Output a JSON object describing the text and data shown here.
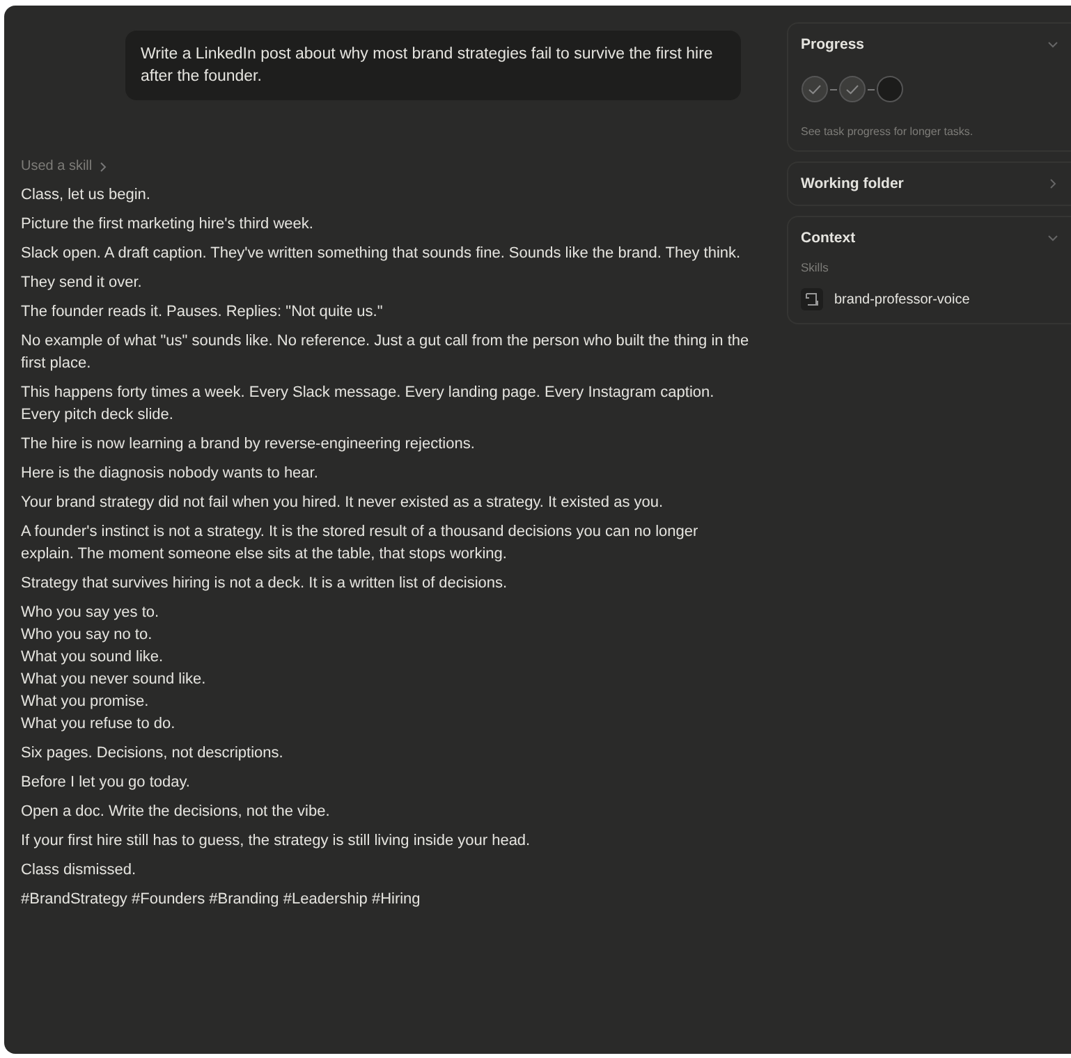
{
  "prompt": "Write a LinkedIn post about why most brand strategies fail to survive the first hire after the founder.",
  "skill_link": "Used a skill",
  "paragraphs": [
    {
      "kind": "text",
      "text": "Class, let us begin."
    },
    {
      "kind": "text",
      "text": "Picture the first marketing hire's third week."
    },
    {
      "kind": "text",
      "text": "Slack open. A draft caption. They've written something that sounds fine. Sounds like the brand. They think."
    },
    {
      "kind": "text",
      "text": "They send it over."
    },
    {
      "kind": "text",
      "text": "The founder reads it. Pauses. Replies: \"Not quite us.\""
    },
    {
      "kind": "text",
      "text": "No example of what \"us\" sounds like. No reference. Just a gut call from the person who built the thing in the first place."
    },
    {
      "kind": "text",
      "text": "This happens forty times a week. Every Slack message. Every landing page. Every Instagram caption. Every pitch deck slide."
    },
    {
      "kind": "text",
      "text": "The hire is now learning a brand by reverse-engineering rejections."
    },
    {
      "kind": "text",
      "text": "Here is the diagnosis nobody wants to hear."
    },
    {
      "kind": "text",
      "text": "Your brand strategy did not fail when you hired. It never existed as a strategy. It existed as you."
    },
    {
      "kind": "text",
      "text": "A founder's instinct is not a strategy. It is the stored result of a thousand decisions you can no longer explain. The moment someone else sits at the table, that stops working."
    },
    {
      "kind": "text",
      "text": "Strategy that survives hiring is not a deck. It is a written list of decisions."
    },
    {
      "kind": "lines",
      "lines": [
        "Who you say yes to.",
        "Who you say no to.",
        "What you sound like.",
        "What you never sound like.",
        "What you promise.",
        "What you refuse to do."
      ]
    },
    {
      "kind": "text",
      "text": "Six pages. Decisions, not descriptions."
    },
    {
      "kind": "text",
      "text": "Before I let you go today."
    },
    {
      "kind": "text",
      "text": "Open a doc. Write the decisions, not the vibe."
    },
    {
      "kind": "text",
      "text": "If your first hire still has to guess, the strategy is still living inside your head."
    },
    {
      "kind": "text",
      "text": "Class dismissed."
    },
    {
      "kind": "text",
      "text": "#BrandStrategy #Founders #Branding #Leadership #Hiring"
    }
  ],
  "panels": [
    {
      "kind": "progress",
      "title": "Progress",
      "expanded": true,
      "steps": [
        {
          "done": true
        },
        {
          "done": true
        },
        {
          "done": false
        }
      ],
      "note": "See task progress for longer tasks."
    },
    {
      "kind": "folder",
      "title": "Working folder",
      "expanded": false
    },
    {
      "kind": "context",
      "title": "Context",
      "expanded": true,
      "section": "Skills",
      "items": [
        "brand-professor-voice"
      ]
    }
  ]
}
